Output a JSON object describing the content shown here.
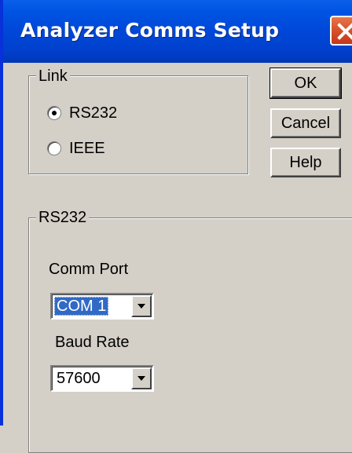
{
  "window": {
    "title": "Analyzer Comms Setup"
  },
  "buttons": {
    "ok": "OK",
    "cancel": "Cancel",
    "help": "Help"
  },
  "link_group": {
    "label": "Link",
    "options": [
      {
        "label": "RS232",
        "checked": true
      },
      {
        "label": "IEEE",
        "checked": false
      }
    ]
  },
  "rs232_group": {
    "label": "RS232",
    "comm_port": {
      "label": "Comm Port",
      "value": "COM 1",
      "selected": true
    },
    "baud_rate": {
      "label": "Baud Rate",
      "value": "57600"
    }
  },
  "colors": {
    "titlebar": "#0054e3",
    "dialog_face": "#d4d0c8",
    "selection": "#316ac5",
    "close_button": "#d8532b"
  }
}
